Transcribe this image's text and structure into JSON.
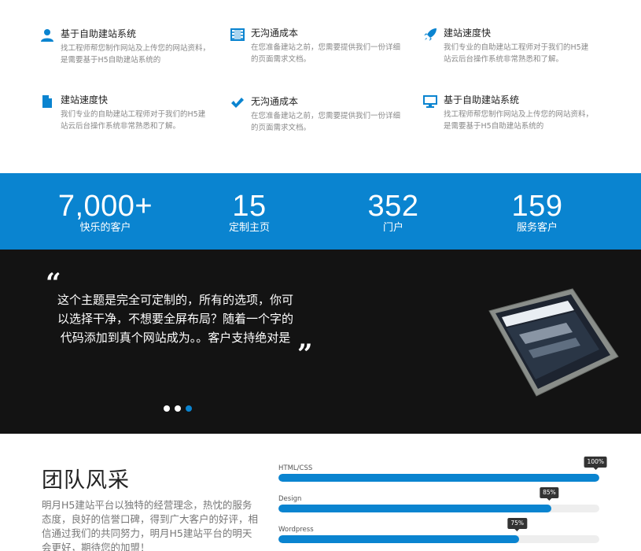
{
  "features": [
    {
      "icon": "user-icon",
      "title": "基于自助建站系统",
      "desc": "找工程师帮您制作网站及上传您的网站资料，是需要基于H5自助建站系统的"
    },
    {
      "icon": "film-icon",
      "title": "无沟通成本",
      "desc": "在您准备建站之前，您需要提供我们一份详细的页面需求文档。"
    },
    {
      "icon": "rocket-icon",
      "title": "建站速度快",
      "desc": "我们专业的自助建站工程师对于我们的H5建站云后台操作系统非常熟悉和了解。"
    },
    {
      "icon": "document-icon",
      "title": "建站速度快",
      "desc": "我们专业的自助建站工程师对于我们的H5建站云后台操作系统非常熟悉和了解。"
    },
    {
      "icon": "checkmark-icon",
      "title": "无沟通成本",
      "desc": "在您准备建站之前，您需要提供我们一份详细的页面需求文档。"
    },
    {
      "icon": "monitor-icon",
      "title": "基于自助建站系统",
      "desc": "找工程师帮您制作网站及上传您的网站资料，是需要基于H5自助建站系统的"
    }
  ],
  "stats": [
    {
      "value": "7,000+",
      "label": "快乐的客户"
    },
    {
      "value": "15",
      "label": "定制主页"
    },
    {
      "value": "352",
      "label": "门户"
    },
    {
      "value": "159",
      "label": "服务客户"
    }
  ],
  "testimonial": {
    "open_quote": "“",
    "close_quote": "”",
    "text": "这个主题是完全可定制的，所有的选项，你可以选择干净，不想要全屏布局？随着一个字的代码添加到真个网站成为。。客户支持绝对是",
    "dots": 3,
    "active_dot": 2
  },
  "team": {
    "title": "团队风采",
    "desc": "明月H5建站平台以独特的经营理念，热忱的服务态度，良好的信誉口碑，得到广大客户的好评，相信通过我们的共同努力，明月H5建站平台的明天会更好，期待您的加盟！"
  },
  "skills": [
    {
      "name": "HTML/CSS",
      "percent": 100,
      "label": "100%"
    },
    {
      "name": "Design",
      "percent": 85,
      "label": "85%"
    },
    {
      "name": "Wordpress",
      "percent": 75,
      "label": "75%"
    }
  ],
  "colors": {
    "accent": "#0a84d0",
    "dark": "#131313"
  }
}
